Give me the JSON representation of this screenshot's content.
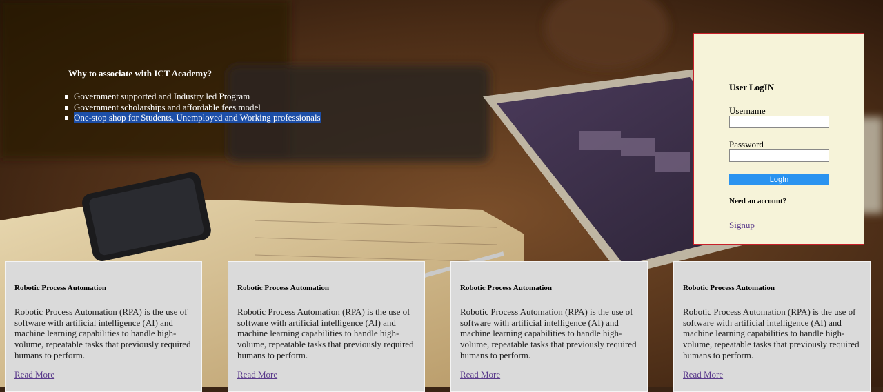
{
  "hero": {
    "heading": "Why to associate with ICT Academy?",
    "points": [
      "Government supported and Industry led Program",
      "Government scholarships and affordable fees model",
      "One-stop shop for Students, Unemployed and Working professionals"
    ]
  },
  "login": {
    "title": "User LogIN",
    "username_label": "Username",
    "username_value": "",
    "password_label": "Password",
    "password_value": "",
    "button_label": "LogIn",
    "need_account": "Need an account?",
    "signup_label": "Signup"
  },
  "cards": [
    {
      "title": "Robotic Process Automation",
      "description": "Robotic Process Automation (RPA) is the use of software with artificial intelligence (AI) and machine learning capabilities to handle high-volume, repeatable tasks that previously required humans to perform.",
      "link": "Read More"
    },
    {
      "title": "Robotic Process Automation",
      "description": "Robotic Process Automation (RPA) is the use of software with artificial intelligence (AI) and machine learning capabilities to handle high-volume, repeatable tasks that previously required humans to perform.",
      "link": "Read More"
    },
    {
      "title": "Robotic Process Automation",
      "description": "Robotic Process Automation (RPA) is the use of software with artificial intelligence (AI) and machine learning capabilities to handle high-volume, repeatable tasks that previously required humans to perform.",
      "link": "Read More"
    },
    {
      "title": "Robotic Process Automation",
      "description": "Robotic Process Automation (RPA) is the use of software with artificial intelligence (AI) and machine learning capabilities to handle high-volume, repeatable tasks that previously required humans to perform.",
      "link": "Read More"
    }
  ],
  "colors": {
    "login_background": "#f6f3d9",
    "login_border": "#c8202a",
    "login_button": "#2a93f0",
    "card_background": "#dadada",
    "link": "#5b3b8c",
    "selection": "#1d4fa8"
  }
}
